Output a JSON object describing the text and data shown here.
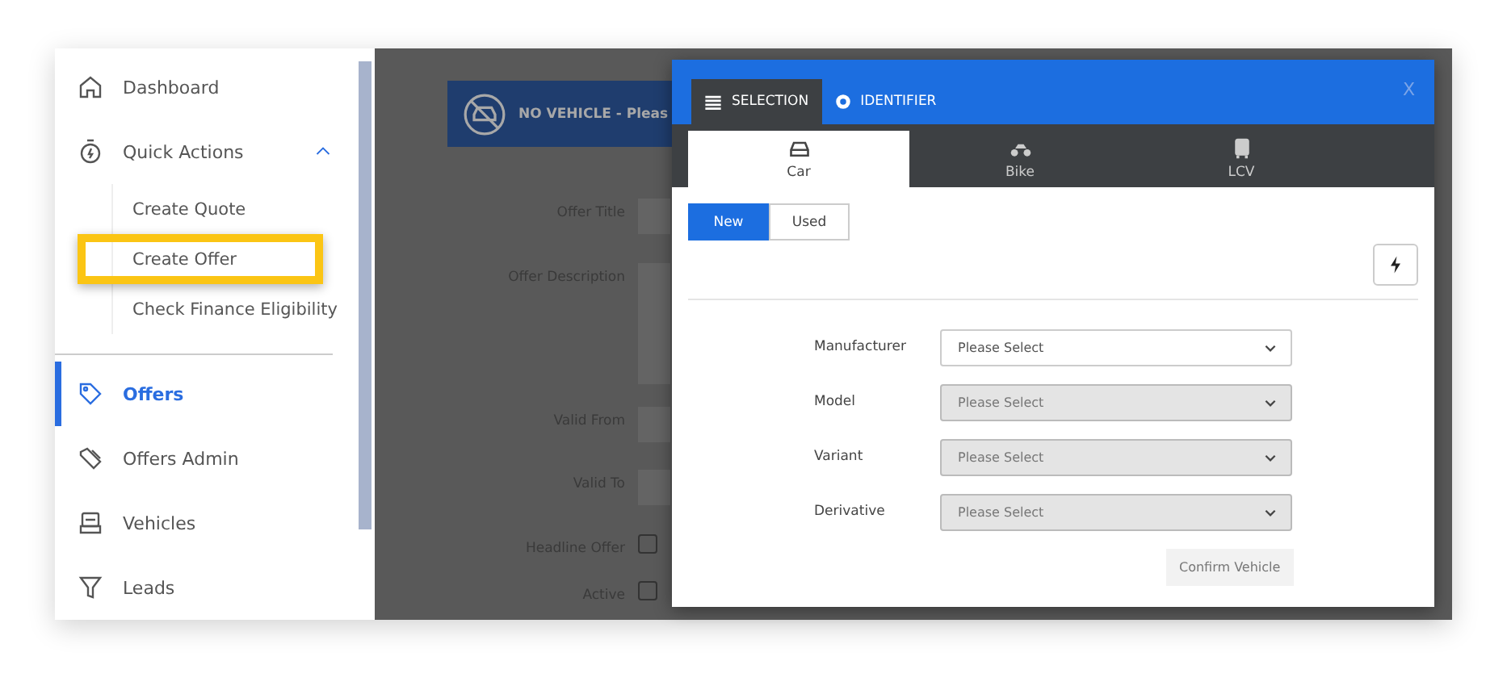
{
  "sidebar": {
    "items": [
      {
        "label": "Dashboard",
        "selected": false
      },
      {
        "label": "Quick Actions",
        "selected": false,
        "expanded": true,
        "children": [
          {
            "label": "Create Quote",
            "highlighted": false
          },
          {
            "label": "Create Offer",
            "highlighted": true
          },
          {
            "label": "Check Finance Eligibility",
            "highlighted": false
          }
        ]
      },
      {
        "label": "Offers",
        "selected": true
      },
      {
        "label": "Offers Admin",
        "selected": false
      },
      {
        "label": "Vehicles",
        "selected": false
      },
      {
        "label": "Leads",
        "selected": false
      }
    ]
  },
  "background_form": {
    "banner": "NO VEHICLE - Pleas",
    "fields": [
      {
        "label": "Offer Title",
        "kind": "input"
      },
      {
        "label": "Offer Description",
        "kind": "textarea"
      },
      {
        "label": "Valid From",
        "kind": "input"
      },
      {
        "label": "Valid To",
        "kind": "input"
      },
      {
        "label": "Headline Offer",
        "kind": "checkbox",
        "checked": false
      },
      {
        "label": "Active",
        "kind": "checkbox",
        "checked": false
      }
    ]
  },
  "modal": {
    "close": "X",
    "tabs": [
      {
        "label": "SELECTION",
        "selected": true
      },
      {
        "label": "IDENTIFIER",
        "selected": false
      }
    ],
    "vehicle_types": [
      {
        "label": "Car",
        "selected": true
      },
      {
        "label": "Bike",
        "selected": false
      },
      {
        "label": "LCV",
        "selected": false
      }
    ],
    "condition": [
      {
        "label": "New",
        "selected": true
      },
      {
        "label": "Used",
        "selected": false
      }
    ],
    "fields": [
      {
        "label": "Manufacturer",
        "placeholder": "Please Select",
        "disabled": false
      },
      {
        "label": "Model",
        "placeholder": "Please Select",
        "disabled": true
      },
      {
        "label": "Variant",
        "placeholder": "Please Select",
        "disabled": true
      },
      {
        "label": "Derivative",
        "placeholder": "Please Select",
        "disabled": true
      }
    ],
    "confirm": {
      "label": "Confirm Vehicle",
      "disabled": true
    }
  }
}
